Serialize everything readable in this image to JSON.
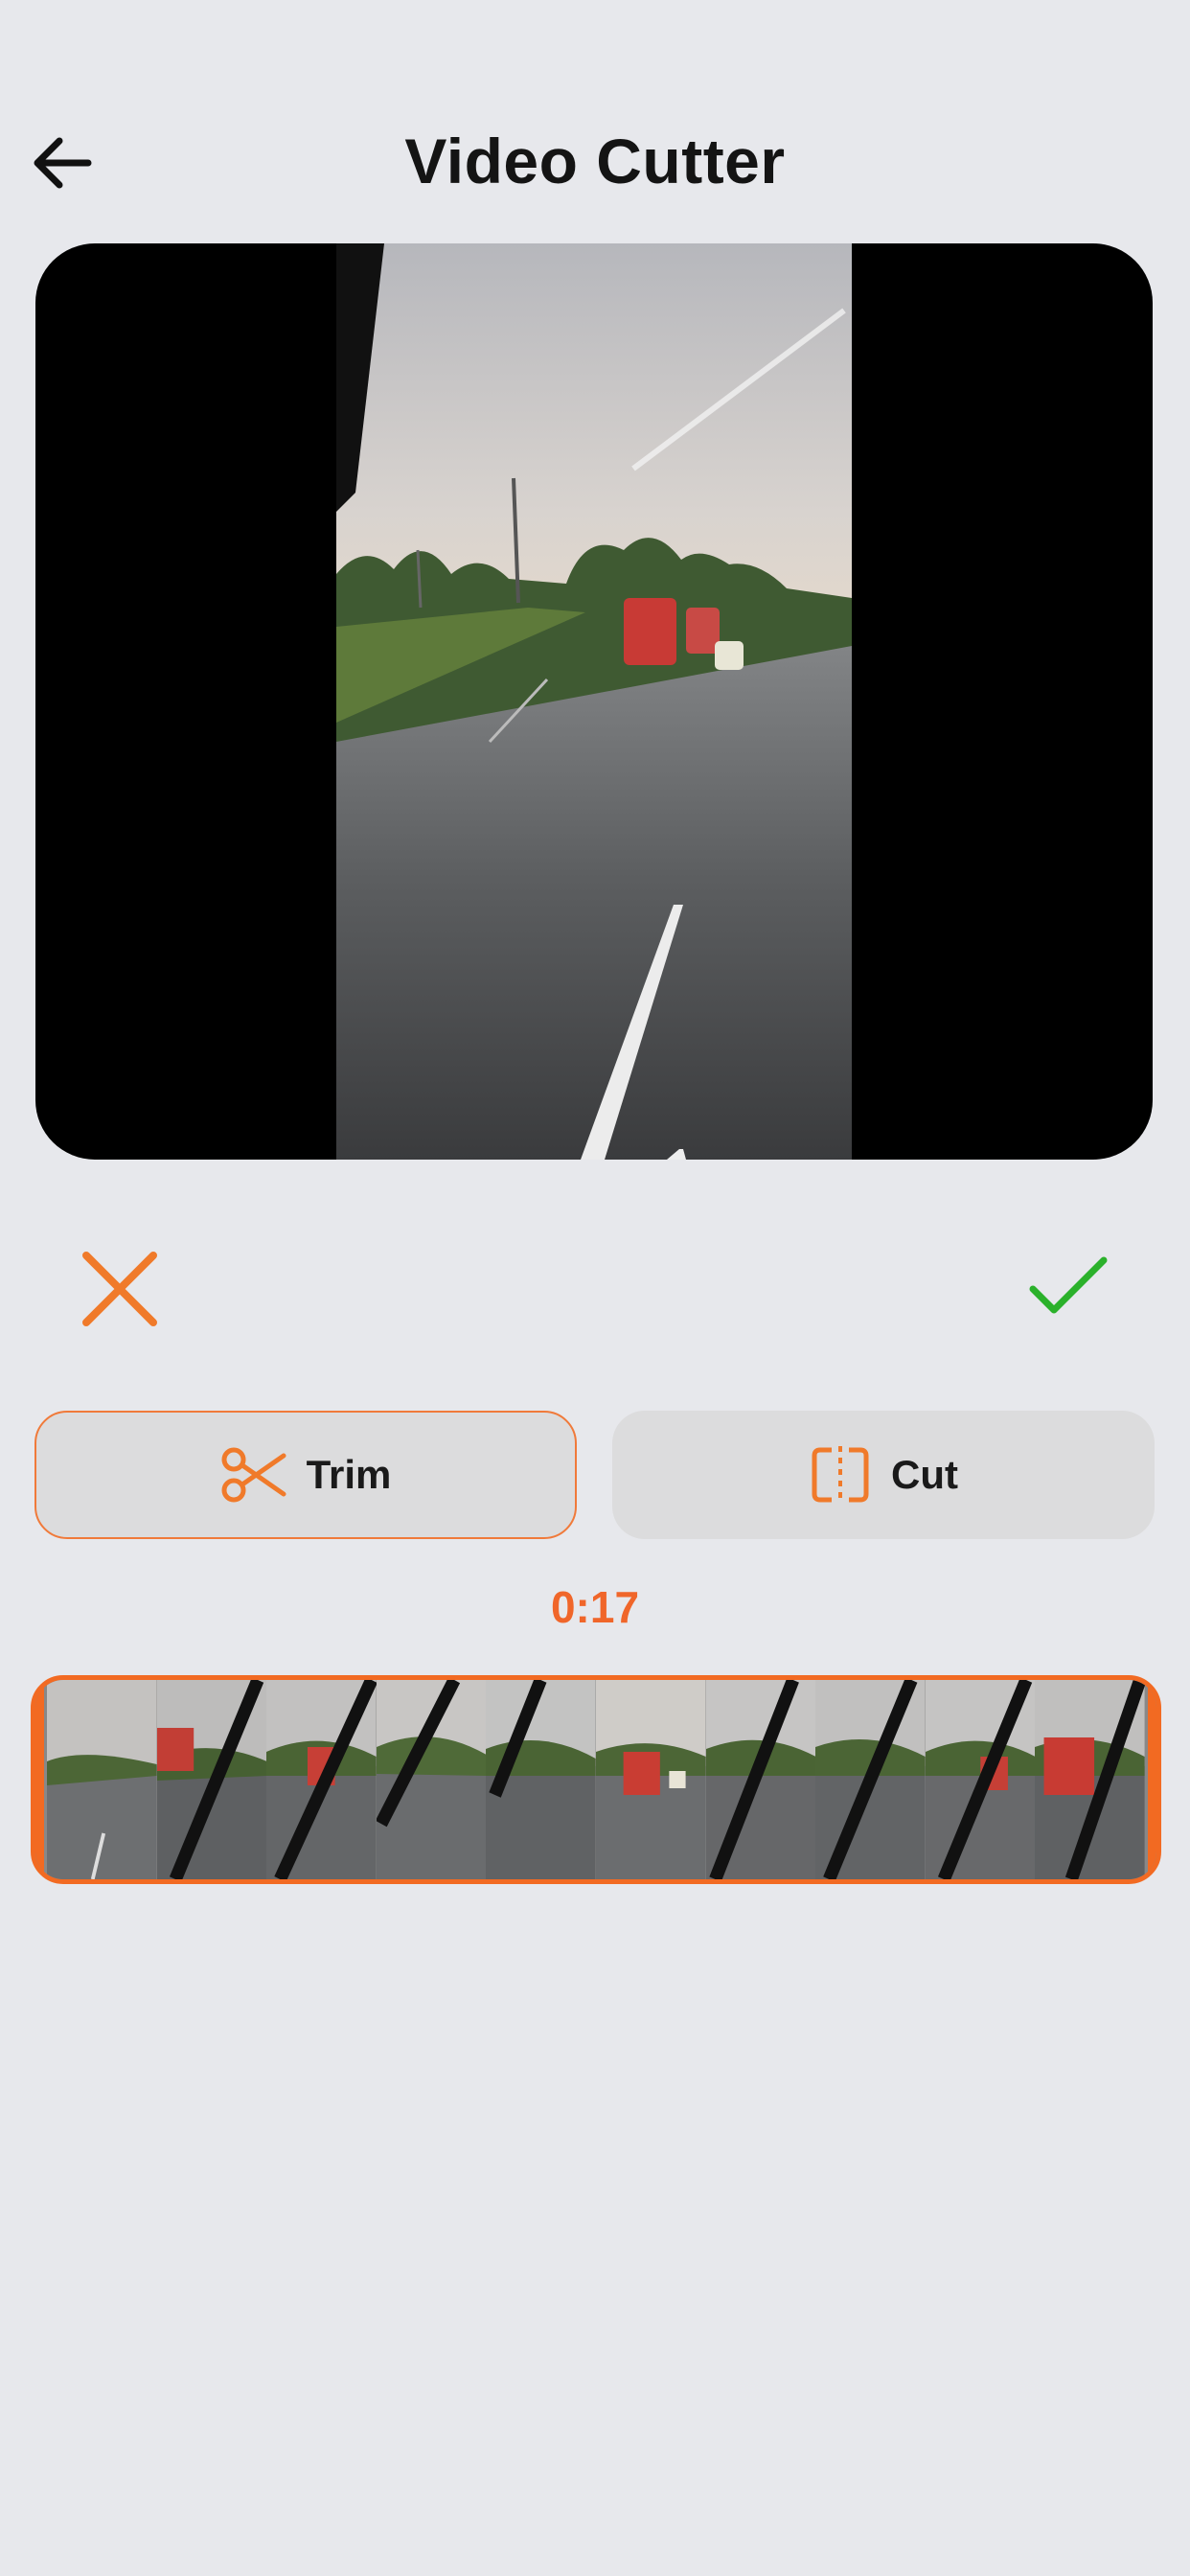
{
  "header": {
    "title": "Video Cutter",
    "back_icon": "arrow-left-icon"
  },
  "player": {
    "background_color": "#000000"
  },
  "actions": {
    "cancel_icon": "close-icon",
    "confirm_icon": "checkmark-icon",
    "cancel_color": "#f07a2a",
    "confirm_color": "#2bb12b"
  },
  "modes": [
    {
      "label": "Trim",
      "icon": "scissors-icon",
      "selected": true
    },
    {
      "label": "Cut",
      "icon": "split-icon",
      "selected": false
    }
  ],
  "timeline": {
    "current_time": "0:17",
    "accent_color": "#f26a22",
    "thumbnail_count": 10
  }
}
